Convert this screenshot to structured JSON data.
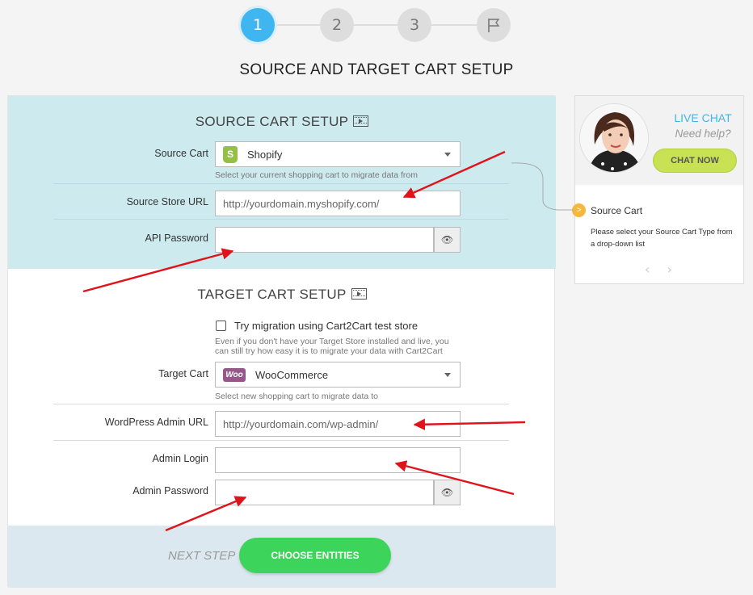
{
  "stepper": {
    "steps": [
      "1",
      "2",
      "3"
    ],
    "active": 0,
    "final_icon": "flag-icon"
  },
  "page_title": "SOURCE AND TARGET CART SETUP",
  "source": {
    "title": "SOURCE CART SETUP",
    "cart_label": "Source Cart",
    "cart_value": "Shopify",
    "cart_hint": "Select your current shopping cart to migrate data from",
    "url_label": "Source Store URL",
    "url_placeholder": "http://yourdomain.myshopify.com/",
    "api_label": "API Password"
  },
  "target": {
    "title": "TARGET CART SETUP",
    "test_store_label": "Try migration using Cart2Cart test store",
    "test_store_hint_1": "Even if you don't have your Target Store installed and live, you",
    "test_store_hint_2": "can still try how easy it is to migrate your data with Cart2Cart",
    "cart_label": "Target Cart",
    "cart_value": "WooCommerce",
    "cart_hint": "Select new shopping cart to migrate data to",
    "url_label": "WordPress Admin URL",
    "url_placeholder": "http://yourdomain.com/wp-admin/",
    "login_label": "Admin Login",
    "password_label": "Admin Password"
  },
  "footer": {
    "next_step": "NEXT STEP",
    "button": "CHOOSE ENTITIES"
  },
  "side": {
    "live_chat": "LIVE CHAT",
    "need_help": "Need help?",
    "chat_now": "CHAT NOW",
    "badge": ">",
    "tip_title": "Source Cart",
    "tip_desc": "Please select your Source Cart Type from a drop-down list",
    "nav": "‹ ›"
  },
  "colors": {
    "accent": "#3fb6ef",
    "source_bg": "#cdeaef",
    "button": "#3dd45b",
    "chat": "#c9e254",
    "arrow": "#e0131a"
  }
}
